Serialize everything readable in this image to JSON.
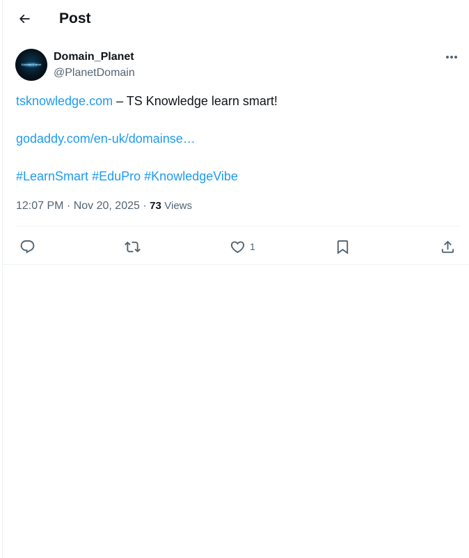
{
  "header": {
    "title": "Post",
    "back_icon": "arrow-left-icon"
  },
  "post": {
    "author": {
      "display_name": "Domain_Planet",
      "handle": "@PlanetDomain",
      "avatar_text": "Domain Planet"
    },
    "body": {
      "line1_link": "tsknowledge.com",
      "line1_text": " – TS Knowledge learn smart!",
      "line2_link": "godaddy.com/en-uk/domainse…",
      "hashtags": [
        "#LearnSmart",
        "#EduPro",
        "#KnowledgeVibe"
      ]
    },
    "meta": {
      "time": "12:07 PM",
      "separator": " · ",
      "date": "Nov 20, 2025",
      "views_count": "73",
      "views_label": "Views"
    },
    "actions": {
      "reply_icon": "reply-icon",
      "repost_icon": "repost-icon",
      "like_icon": "heart-icon",
      "like_count": "1",
      "bookmark_icon": "bookmark-icon",
      "share_icon": "share-icon"
    },
    "more_icon": "more-dots-icon"
  },
  "colors": {
    "accent": "#1d9bf0",
    "text": "#0f1419",
    "secondary": "#536471",
    "border": "#eff3f4"
  }
}
